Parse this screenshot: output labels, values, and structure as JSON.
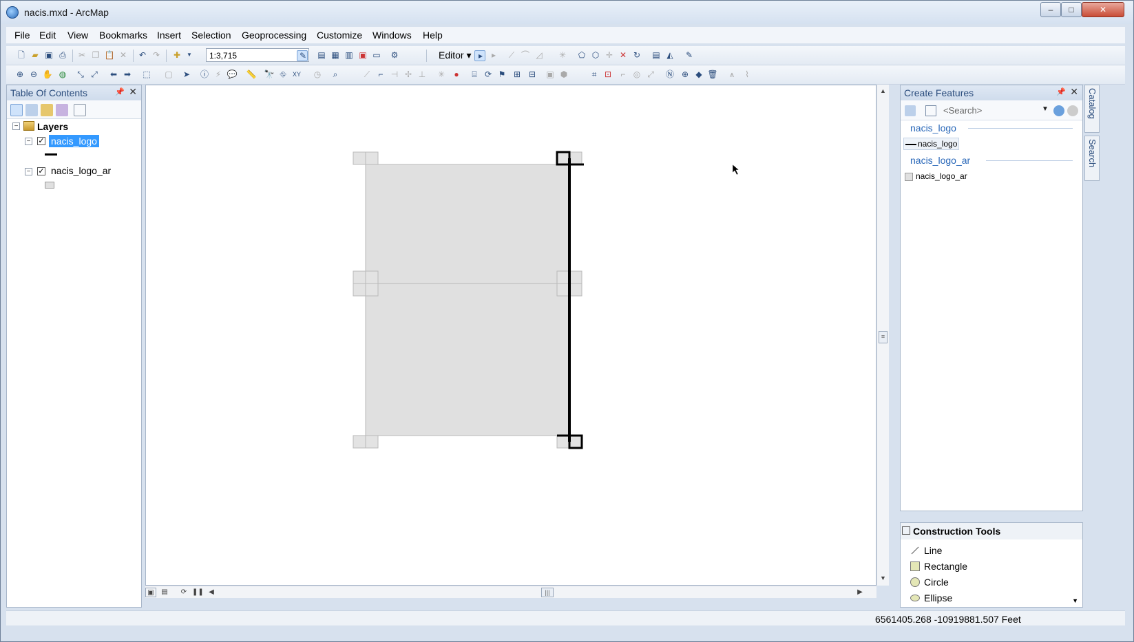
{
  "window": {
    "title": "nacis.mxd - ArcMap"
  },
  "menu": [
    "File",
    "Edit",
    "View",
    "Bookmarks",
    "Insert",
    "Selection",
    "Geoprocessing",
    "Customize",
    "Windows",
    "Help"
  ],
  "toolbar": {
    "scale": "1:3,715",
    "editor_label": "Editor"
  },
  "toc": {
    "title": "Table Of Contents",
    "root_label": "Layers",
    "layers": [
      {
        "name": "nacis_logo",
        "checked": true,
        "selected": true
      },
      {
        "name": "nacis_logo_ar",
        "checked": true,
        "selected": false
      }
    ]
  },
  "create_features": {
    "title": "Create Features",
    "search_placeholder": "<Search>",
    "groups": [
      {
        "name": "nacis_logo",
        "template": "nacis_logo"
      },
      {
        "name": "nacis_logo_ar",
        "template": "nacis_logo_ar"
      }
    ]
  },
  "construction_tools": {
    "title": "Construction Tools",
    "items": [
      "Line",
      "Rectangle",
      "Circle",
      "Ellipse"
    ]
  },
  "side_tabs": [
    "Catalog",
    "Search"
  ],
  "status": {
    "coordinates": "6561405.268  -10919881.507 Feet"
  },
  "colors": {
    "selection": "#3399ff",
    "polygon_fill": "#e0e0e0",
    "line": "#000000"
  }
}
